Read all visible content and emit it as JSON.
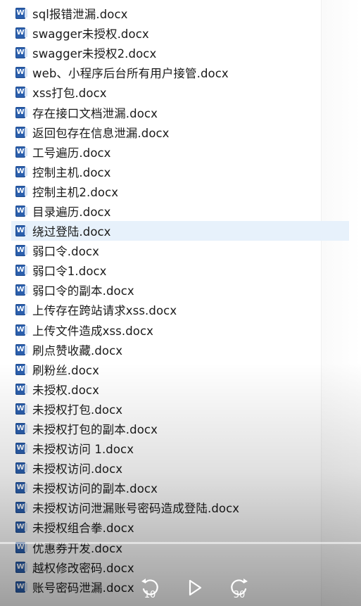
{
  "files": [
    {
      "name": "sql报错泄漏.docx",
      "icon": "word-doc-icon"
    },
    {
      "name": "swagger未授权.docx",
      "icon": "word-doc-icon"
    },
    {
      "name": "swagger未授权2.docx",
      "icon": "word-doc-icon"
    },
    {
      "name": "web、小程序后台所有用户接管.docx",
      "icon": "word-doc-icon"
    },
    {
      "name": "xss打包.docx",
      "icon": "word-doc-icon"
    },
    {
      "name": "存在接口文档泄漏.docx",
      "icon": "word-doc-icon"
    },
    {
      "name": "返回包存在信息泄漏.docx",
      "icon": "word-doc-icon"
    },
    {
      "name": "工号遍历.docx",
      "icon": "word-doc-icon"
    },
    {
      "name": "控制主机.docx",
      "icon": "word-doc-icon"
    },
    {
      "name": "控制主机2.docx",
      "icon": "word-doc-icon"
    },
    {
      "name": "目录遍历.docx",
      "icon": "word-doc-icon"
    },
    {
      "name": "绕过登陆.docx",
      "icon": "word-doc-icon",
      "selected": true
    },
    {
      "name": "弱口令.docx",
      "icon": "word-doc-icon"
    },
    {
      "name": "弱口令1.docx",
      "icon": "word-doc-icon"
    },
    {
      "name": "弱口令的副本.docx",
      "icon": "word-doc-icon"
    },
    {
      "name": "上传存在跨站请求xss.docx",
      "icon": "word-doc-icon"
    },
    {
      "name": "上传文件造成xss.docx",
      "icon": "word-doc-icon"
    },
    {
      "name": "刷点赞收藏.docx",
      "icon": "word-doc-icon"
    },
    {
      "name": "刷粉丝.docx",
      "icon": "word-doc-icon"
    },
    {
      "name": "未授权.docx",
      "icon": "word-doc-icon"
    },
    {
      "name": "未授权打包.docx",
      "icon": "word-doc-icon"
    },
    {
      "name": "未授权打包的副本.docx",
      "icon": "word-doc-icon"
    },
    {
      "name": "未授权访问 1.docx",
      "icon": "word-doc-icon"
    },
    {
      "name": "未授权访问.docx",
      "icon": "word-doc-icon"
    },
    {
      "name": "未授权访问的副本.docx",
      "icon": "word-doc-icon"
    },
    {
      "name": "未授权访问泄漏账号密码造成登陆.docx",
      "icon": "word-doc-icon"
    },
    {
      "name": "未授权组合拳.docx",
      "icon": "word-doc-icon"
    },
    {
      "name": "优惠券开发.docx",
      "icon": "word-doc-icon"
    },
    {
      "name": "越权修改密码.docx",
      "icon": "word-doc-icon"
    },
    {
      "name": "账号密码泄漏.docx",
      "icon": "word-doc-icon"
    }
  ],
  "player": {
    "rewind_seconds": "10",
    "forward_seconds": "30",
    "progress_fraction": 0.0
  },
  "colors": {
    "selection": "#e7f1fb",
    "word_icon": "#2b5fad"
  }
}
